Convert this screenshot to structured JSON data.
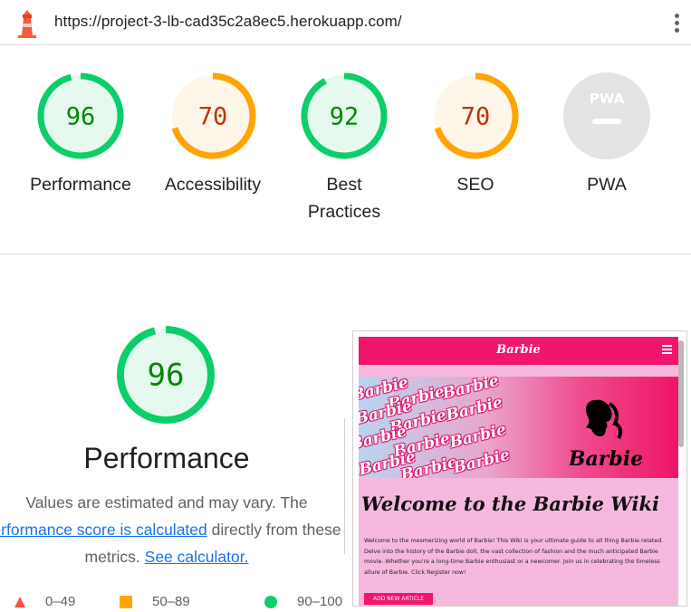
{
  "url_bar": {
    "url": "https://project-3-lb-cad35c2a8ec5.herokuapp.com/",
    "app_icon": "lighthouse-icon",
    "menu_icon": "kebab-menu-icon"
  },
  "gauges": [
    {
      "score": "96",
      "label": "Performance",
      "status": "pass",
      "fraction": 0.96
    },
    {
      "score": "70",
      "label": "Accessibility",
      "status": "average",
      "fraction": 0.7
    },
    {
      "score": "92",
      "label": "Best Practices",
      "status": "pass",
      "fraction": 0.92
    },
    {
      "score": "70",
      "label": "SEO",
      "status": "average",
      "fraction": 0.7
    },
    {
      "score": "PWA",
      "label": "PWA",
      "status": "na",
      "fraction": 0
    }
  ],
  "colors": {
    "pass": "#0cce6b",
    "pass_text": "#008800",
    "pass_fill": "#e6f9ee",
    "average": "#ffa400",
    "average_text": "#c33300",
    "average_fill": "#fff6ea",
    "fail": "#ff4e42",
    "na": "#cccccc",
    "link": "#1a73e8",
    "barbie_pink": "#f0166e",
    "barbie_bg": "#f7b8df"
  },
  "performance": {
    "score": "96",
    "fraction": 0.96,
    "title": "Performance",
    "desc_line1": "Values are estimated and may vary. The",
    "desc_link1": "erformance score is calculated",
    "desc_mid": " directly from these",
    "desc_pre2": "metrics. ",
    "desc_link2": "See calculator.",
    "legend": [
      {
        "shape": "triangle",
        "text": "0–49"
      },
      {
        "shape": "square",
        "text": "50–89"
      },
      {
        "shape": "circle",
        "text": "90–100"
      }
    ]
  },
  "screenshot": {
    "brand": "Barbie",
    "hero_word": "Barbie",
    "hero_logo_text": "Barbie",
    "heading": "Welcome to the Barbie Wiki",
    "body": "Welcome to the mesmerizing world of Barbie! This Wiki is your ultimate guide to all thing Barbie related. Delve into the history of the Barbie doll, the vast collection of fashion and the much anticipated Barbie movie. Whether you're a long-time Barbie enthusiast or a newcomer. Join us in celebrating the timeless allure of Barbie. Click Register now!",
    "button": "ADD NEW ARTICLE"
  }
}
